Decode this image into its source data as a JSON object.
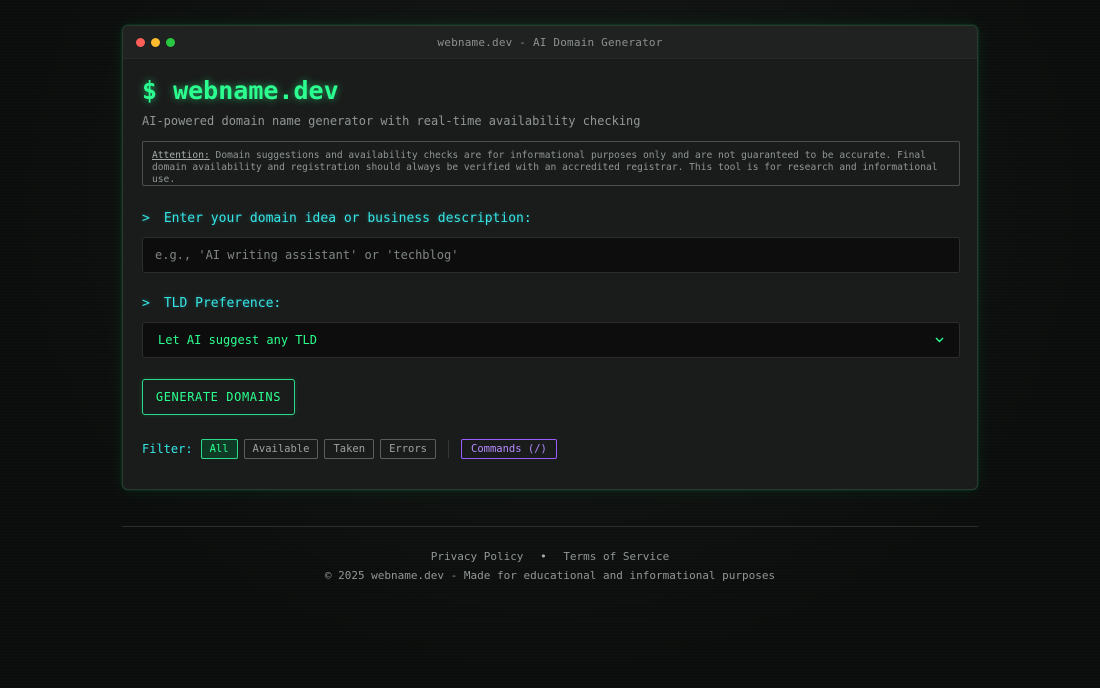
{
  "window": {
    "title": "webname.dev - AI Domain Generator"
  },
  "header": {
    "prompt_symbol": "$",
    "brand": "webname.dev",
    "subtitle": "AI-powered domain name generator with real-time availability checking"
  },
  "notice": {
    "label": "Attention:",
    "text": "Domain suggestions and availability checks are for informational purposes only and are not guaranteed to be accurate. Final domain availability and registration should always be verified with an accredited registrar. This tool is for research and informational use."
  },
  "form": {
    "prompt_marker": ">",
    "domain_label": "Enter your domain idea or business description:",
    "domain_placeholder": "e.g., 'AI writing assistant' or 'techblog'",
    "tld_label": "TLD Preference:",
    "tld_selected": "Let AI suggest any TLD",
    "generate_label": "GENERATE DOMAINS"
  },
  "filters": {
    "label": "Filter:",
    "options": [
      "All",
      "Available",
      "Taken",
      "Errors"
    ],
    "active": "All",
    "commands_label": "Commands (/)"
  },
  "footer": {
    "privacy": "Privacy Policy",
    "bullet": "•",
    "terms": "Terms of Service",
    "copyright": "© 2025 webname.dev - Made for educational and informational purposes"
  },
  "colors": {
    "accent_green": "#2bff8f",
    "accent_cyan": "#35e6e6",
    "accent_purple": "#9a5cff",
    "background": "#0b0d0c"
  },
  "icons": {
    "window_controls": [
      "close-dot",
      "minimize-dot",
      "maximize-dot"
    ],
    "select_arrow": "chevron-down-icon"
  }
}
